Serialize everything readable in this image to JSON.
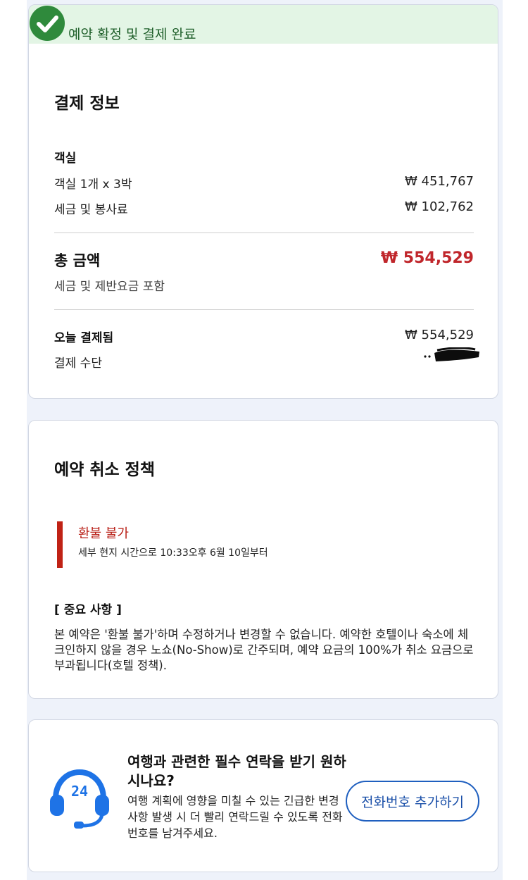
{
  "confirmation": {
    "banner_text": "예약 확정 및 결제 완료",
    "icon": "check-circle-icon",
    "color": "#2f8a3c"
  },
  "payment": {
    "title": "결제 정보",
    "room_heading": "객실",
    "room_line_label": "객실 1개 x 3박",
    "room_line_amount": "₩ 451,767",
    "tax_label": "세금 및 봉사료",
    "tax_amount": "₩ 102,762",
    "total_label": "총 금액",
    "total_amount": "₩ 554,529",
    "total_note": "세금 및 제반요금 포함",
    "paid_today_label": "오늘 결제됨",
    "paid_today_amount": "₩ 554,529",
    "method_label": "결제 수단",
    "total_color": "#c0262b"
  },
  "cancellation": {
    "title": "예약 취소 정책",
    "refund_title": "환불 불가",
    "refund_subtitle": "세부 현지 시간으로 10:33오후 6월 10일부터",
    "notice_title": "[ 중요 사항 ]",
    "notice_body": "본 예약은 '환불 불가'하며 수정하거나 변경할 수 없습니다. 예약한 호텔이나 숙소에 체크인하지 않을 경우 노쇼(No-Show)로 간주되며, 예약 요금의 100%가 취소 요금으로 부과됩니다(호텔 정책).",
    "accent_color": "#c02215"
  },
  "contact": {
    "icon": "headset-24-icon",
    "title": "여행과 관련한 필수 연락을 받기 원하시나요?",
    "body": "여행 계획에 영향을 미칠 수 있는 긴급한 변경 사항 발생 시 더 빨리 연락드릴 수 있도록 전화번호를 남겨주세요.",
    "button_label": "전화번호 추가하기",
    "button_color": "#1f5fbf"
  }
}
